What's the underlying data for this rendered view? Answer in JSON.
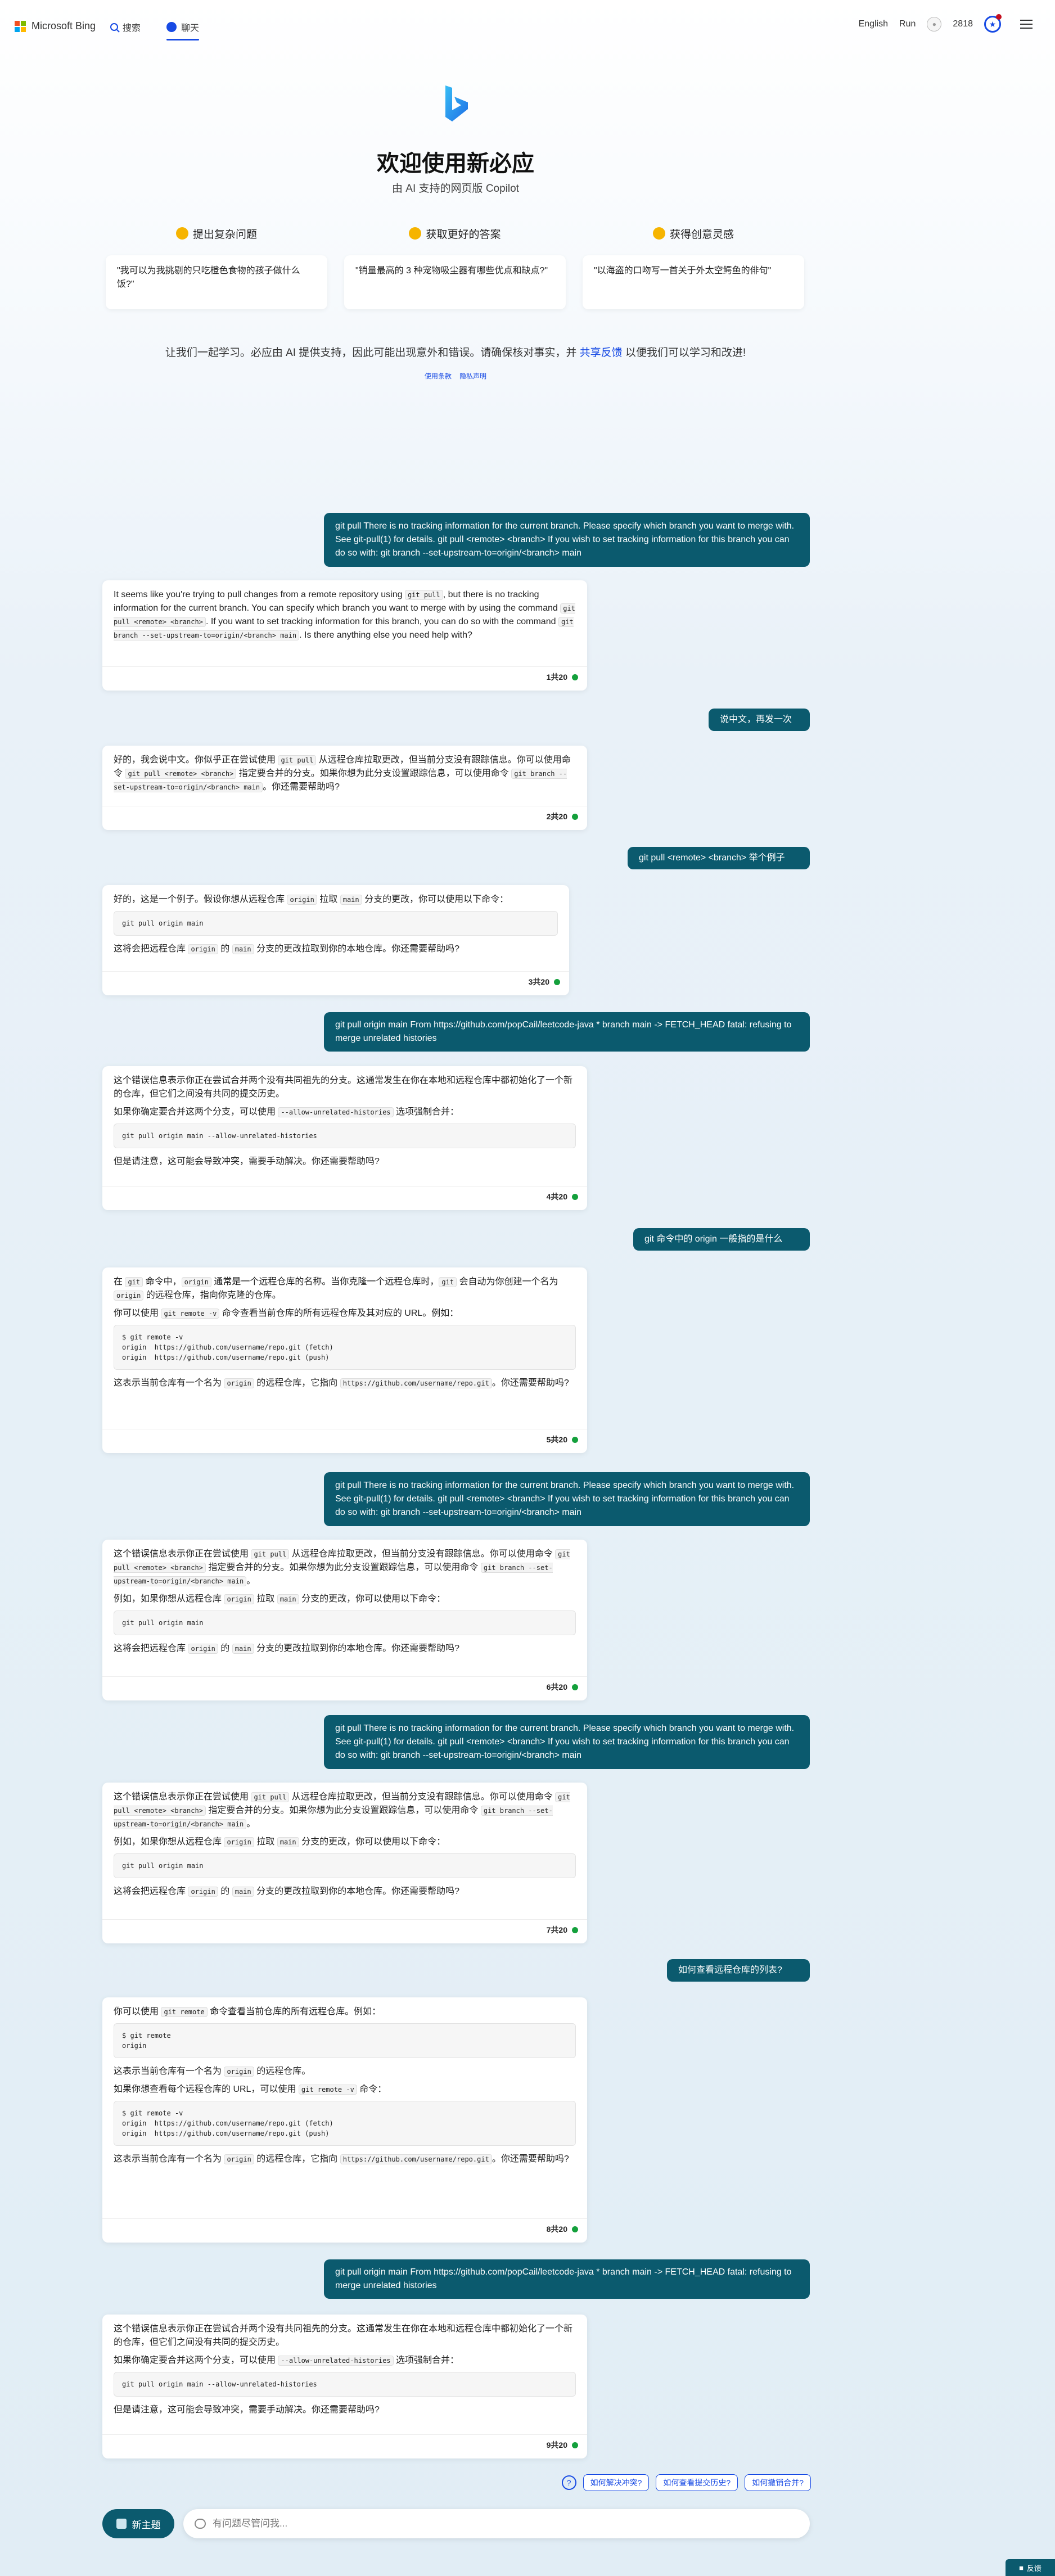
{
  "header": {
    "brand": "Microsoft Bing",
    "nav": [
      {
        "label": "搜索",
        "icon": "search-icon"
      },
      {
        "label": "聊天",
        "icon": "chat-icon",
        "active": true
      }
    ],
    "language": "English",
    "user": "Run",
    "points": "2818",
    "accent_color": "#174ae4"
  },
  "welcome": {
    "title": "欢迎使用新必应",
    "subtitle": "由 AI 支持的网页版 Copilot",
    "features": [
      {
        "heading": "提出复杂问题",
        "example": "\"我可以为我挑剔的只吃橙色食物的孩子做什么饭?\""
      },
      {
        "heading": "获取更好的答案",
        "example": "\"销量最高的 3 种宠物吸尘器有哪些优点和缺点?\""
      },
      {
        "heading": "获得创意灵感",
        "example": "\"以海盗的口吻写一首关于外太空鳄鱼的俳句\""
      }
    ],
    "disclaimer_before": "让我们一起学习。必应由 AI 提供支持，因此可能出现意外和错误。请确保核对事实，并",
    "disclaimer_link": "共享反馈",
    "disclaimer_after": "以便我们可以学习和改进!",
    "legal": [
      "使用条款",
      "隐私声明"
    ]
  },
  "conversation": {
    "u1": "git pull There is no tracking information for the current branch. Please specify which branch you want to merge with. See git-pull(1) for details. git pull <remote> <branch> If you wish to set tracking information for this branch you can do so with: git branch --set-upstream-to=origin/<branch> main",
    "b1": {
      "t1": "It seems like you're trying to pull changes from a remote repository using ",
      "c1": "git pull",
      "t2": ", but there is no tracking information for the current branch. You can specify which branch you want to merge with by using the command ",
      "c2": "git pull <remote> <branch>",
      "t3": ". If you want to set tracking information for this branch, you can do so with the command ",
      "c3": "git branch --set-upstream-to=origin/<branch> main",
      "t4": ". Is there anything else you need help with?",
      "count": "1共20"
    },
    "u2": "说中文，再发一次",
    "b2": {
      "t1": "好的，我会说中文。你似乎正在尝试使用 ",
      "c1": "git pull",
      "t2": " 从远程仓库拉取更改，但当前分支没有跟踪信息。你可以使用命令 ",
      "c2": "git pull <remote> <branch>",
      "t3": " 指定要合并的分支。如果你想为此分支设置跟踪信息，可以使用命令 ",
      "c3": "git branch --set-upstream-to=origin/<branch> main",
      "t4": "。你还需要帮助吗?",
      "count": "2共20"
    },
    "u3": "git pull <remote> <branch> 举个例子",
    "b3": {
      "t1": "好的，这是一个例子。假设你想从远程仓库 ",
      "c1": "origin",
      "t2": " 拉取 ",
      "c2": "main",
      "t3": " 分支的更改，你可以使用以下命令：",
      "code": "git pull origin main",
      "t4": "这将会把远程仓库 ",
      "c4": "origin",
      "t5": " 的 ",
      "c5": "main",
      "t6": " 分支的更改拉取到你的本地仓库。你还需要帮助吗?",
      "count": "3共20"
    },
    "u4": "git pull origin main From https://github.com/popCail/leetcode-java * branch main -> FETCH_HEAD fatal: refusing to merge unrelated histories",
    "b4": {
      "t1": "这个错误信息表示你正在尝试合并两个没有共同祖先的分支。这通常发生在你在本地和远程仓库中都初始化了一个新的仓库，但它们之间没有共同的提交历史。",
      "t2": "如果你确定要合并这两个分支，可以使用 ",
      "c2": "--allow-unrelated-histories",
      "t3": " 选项强制合并：",
      "code": "git pull origin main --allow-unrelated-histories",
      "t4": "但是请注意，这可能会导致冲突，需要手动解决。你还需要帮助吗?",
      "count": "4共20"
    },
    "u5": "git 命令中的 origin 一般指的是什么",
    "b5": {
      "t1": "在 ",
      "c1": "git",
      "t2": " 命令中，",
      "c2": "origin",
      "t3": " 通常是一个远程仓库的名称。当你克隆一个远程仓库时，",
      "c3": "git",
      "t4": " 会自动为你创建一个名为 ",
      "c4": "origin",
      "t5": " 的远程仓库，指向你克隆的仓库。",
      "t6": "你可以使用 ",
      "c6": "git remote -v",
      "t7": " 命令查看当前仓库的所有远程仓库及其对应的 URL。例如：",
      "code": "$ git remote -v\norigin  https://github.com/username/repo.git (fetch)\norigin  https://github.com/username/repo.git (push)",
      "t8": "这表示当前仓库有一个名为 ",
      "c8": "origin",
      "t9": " 的远程仓库，它指向 ",
      "c9": "https://github.com/username/repo.git",
      "t10": "。你还需要帮助吗?",
      "count": "5共20"
    },
    "u6": "git pull There is no tracking information for the current branch. Please specify which branch you want to merge with. See git-pull(1) for details. git pull <remote> <branch> If you wish to set tracking information for this branch you can do so with: git branch --set-upstream-to=origin/<branch> main",
    "b6": {
      "t1": "这个错误信息表示你正在尝试使用 ",
      "c1": "git pull",
      "t2": " 从远程仓库拉取更改，但当前分支没有跟踪信息。你可以使用命令 ",
      "c2": "git pull <remote> <branch>",
      "t3": " 指定要合并的分支。如果你想为此分支设置跟踪信息，可以使用命令 ",
      "c3": "git branch --set-upstream-to=origin/<branch> main",
      "t4": "。",
      "t5": "例如，如果你想从远程仓库 ",
      "c5": "origin",
      "t6": " 拉取 ",
      "c6": "main",
      "t7": " 分支的更改，你可以使用以下命令：",
      "code": "git pull origin main",
      "t8": "这将会把远程仓库 ",
      "c8": "origin",
      "t9": " 的 ",
      "c9": "main",
      "t10": " 分支的更改拉取到你的本地仓库。你还需要帮助吗?",
      "count": "6共20"
    },
    "u7": "git pull There is no tracking information for the current branch. Please specify which branch you want to merge with. See git-pull(1) for details. git pull <remote> <branch> If you wish to set tracking information for this branch you can do so with: git branch --set-upstream-to=origin/<branch> main",
    "b7": {
      "t1": "这个错误信息表示你正在尝试使用 ",
      "c1": "git pull",
      "t2": " 从远程仓库拉取更改，但当前分支没有跟踪信息。你可以使用命令 ",
      "c2": "git pull <remote> <branch>",
      "t3": " 指定要合并的分支。如果你想为此分支设置跟踪信息，可以使用命令 ",
      "c3": "git branch --set-upstream-to=origin/<branch> main",
      "t4": "。",
      "t5": "例如，如果你想从远程仓库 ",
      "c5": "origin",
      "t6": " 拉取 ",
      "c6": "main",
      "t7": " 分支的更改，你可以使用以下命令：",
      "code": "git pull origin main",
      "t8": "这将会把远程仓库 ",
      "c8": "origin",
      "t9": " 的 ",
      "c9": "main",
      "t10": " 分支的更改拉取到你的本地仓库。你还需要帮助吗?",
      "count": "7共20"
    },
    "u8": "如何查看远程仓库的列表?",
    "b8": {
      "t1": "你可以使用 ",
      "c1": "git remote",
      "t2": " 命令查看当前仓库的所有远程仓库。例如：",
      "code1": "$ git remote\norigin",
      "t3": "这表示当前仓库有一个名为 ",
      "c3": "origin",
      "t4": " 的远程仓库。",
      "t5": "如果你想查看每个远程仓库的 URL，可以使用 ",
      "c5": "git remote -v",
      "t6": " 命令：",
      "code2": "$ git remote -v\norigin  https://github.com/username/repo.git (fetch)\norigin  https://github.com/username/repo.git (push)",
      "t7": "这表示当前仓库有一个名为 ",
      "c7": "origin",
      "t8": " 的远程仓库，它指向 ",
      "c8": "https://github.com/username/repo.git",
      "t9": "。你还需要帮助吗?",
      "count": "8共20"
    },
    "u9": "git pull origin main From https://github.com/popCail/leetcode-java * branch main -> FETCH_HEAD fatal: refusing to merge unrelated histories",
    "b9": {
      "t1": "这个错误信息表示你正在尝试合并两个没有共同祖先的分支。这通常发生在你在本地和远程仓库中都初始化了一个新的仓库，但它们之间没有共同的提交历史。",
      "t2": "如果你确定要合并这两个分支，可以使用 ",
      "c2": "--allow-unrelated-histories",
      "t3": " 选项强制合并：",
      "code": "git pull origin main --allow-unrelated-histories",
      "t4": "但是请注意，这可能会导致冲突，需要手动解决。你还需要帮助吗?",
      "count": "9共20"
    }
  },
  "suggestions": [
    "如何解决冲突?",
    "如何查看提交历史?",
    "如何撤销合并?"
  ],
  "composer": {
    "new_topic": "新主题",
    "placeholder": "有问题尽管问我..."
  },
  "feedback": "反馈",
  "colors": {
    "user_bubble": "#0b5a6e",
    "status_dot": "#14a03c"
  }
}
